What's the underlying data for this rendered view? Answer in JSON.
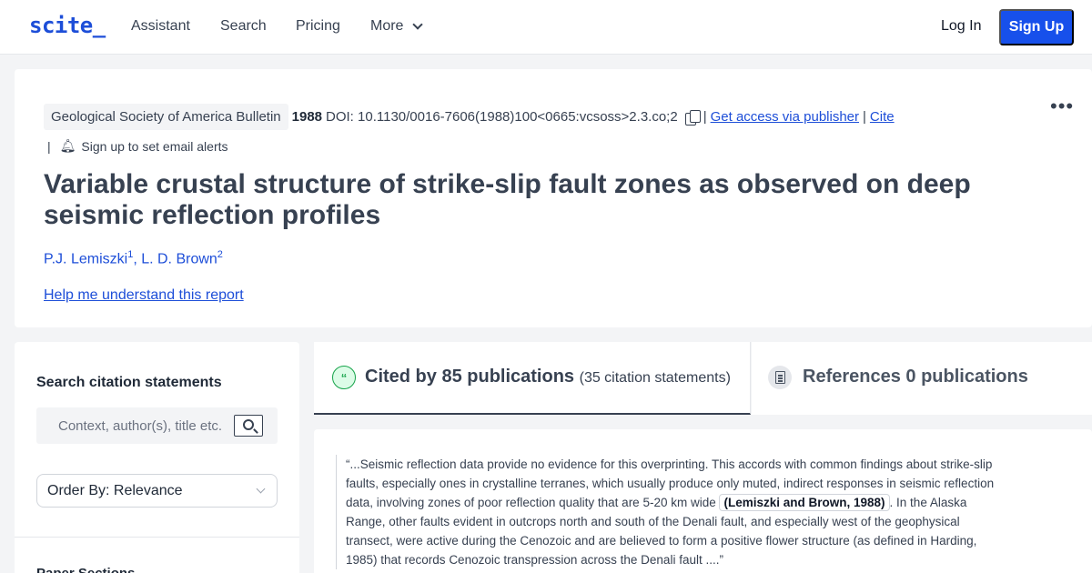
{
  "nav": {
    "logo": "scite_",
    "assistant": "Assistant",
    "search": "Search",
    "pricing": "Pricing",
    "more": "More",
    "login": "Log In",
    "signup": "Sign Up"
  },
  "paper": {
    "journal": "Geological Society of America Bulletin",
    "year": "1988",
    "doi": "DOI: 10.1130/0016-7606(1988)100<0665:vcsoss>2.3.co;2",
    "access_link": "Get access via publisher",
    "cite_link": "Cite",
    "alerts": "Sign up to set email alerts",
    "title": "Variable crustal structure of strike-slip fault zones as observed on deep seismic reflection profiles",
    "authors": [
      {
        "name": "P.J. Lemiszki",
        "affil": "1"
      },
      {
        "name": "L. D. Brown",
        "affil": "2"
      }
    ],
    "help_link": "Help me understand this report"
  },
  "sidebar": {
    "title": "Search citation statements",
    "search_placeholder": "Context, author(s), title etc.",
    "order_by": "Order By: Relevance",
    "next_section": "Paper Sections"
  },
  "tabs": {
    "cited_label": "Cited by 85 publications",
    "cited_sub": "(35 citation statements)",
    "refs_label": "References 0 publications"
  },
  "citation": {
    "before": "“...Seismic reflection data provide no evidence for this overprinting. This accords with common findings about strike-slip faults, especially ones in crystalline terranes, which usually produce only muted, indirect responses in seismic reflection data, involving zones of poor reflection quality that are 5-20 km wide ",
    "ref": "(Lemiszki and Brown, 1988)",
    "after": ". In the Alaska Range, other faults evident in outcrops north and south of the Denali fault, and especially west of the geophysical transect, were active during the Cenozoic and are believed to form a positive flower structure (as defined in Harding, 1985) that records Cenozoic transpression across the Denali fault ....”"
  },
  "colors": {
    "brand": "#1d4ed8",
    "signup_bg": "#1750eb",
    "cited_icon": "#16a34a"
  },
  "icons": [
    "copy-icon",
    "bell-icon",
    "more-options-icon",
    "search-icon",
    "chevron-down-icon",
    "citation-bubble-icon",
    "document-icon"
  ]
}
